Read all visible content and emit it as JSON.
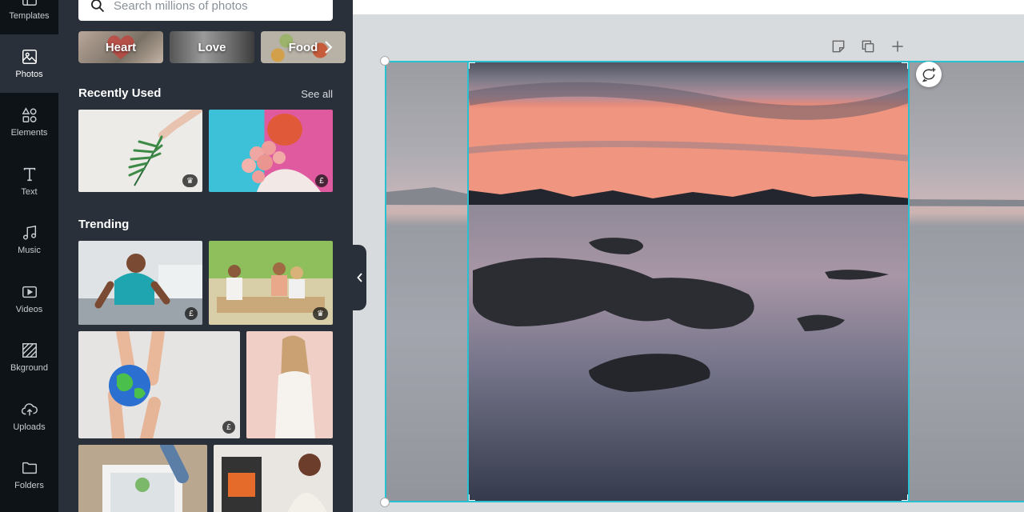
{
  "rail": {
    "items": [
      {
        "label": "Templates",
        "icon": "templates-icon"
      },
      {
        "label": "Photos",
        "icon": "photos-icon"
      },
      {
        "label": "Elements",
        "icon": "elements-icon"
      },
      {
        "label": "Text",
        "icon": "text-icon"
      },
      {
        "label": "Music",
        "icon": "music-icon"
      },
      {
        "label": "Videos",
        "icon": "videos-icon"
      },
      {
        "label": "Bkground",
        "icon": "background-icon"
      },
      {
        "label": "Uploads",
        "icon": "uploads-icon"
      },
      {
        "label": "Folders",
        "icon": "folders-icon"
      }
    ],
    "active": "Photos"
  },
  "search": {
    "placeholder": "Search millions of photos"
  },
  "chips": [
    {
      "label": "Heart"
    },
    {
      "label": "Love"
    },
    {
      "label": "Food"
    }
  ],
  "recently_used": {
    "title": "Recently Used",
    "see_all": "See all",
    "items": [
      {
        "subject": "fern leaf in hand",
        "badge": "crown"
      },
      {
        "subject": "woman with pink roses",
        "badge": "£"
      }
    ]
  },
  "trending": {
    "title": "Trending",
    "items": [
      {
        "subject": "man in kitchen",
        "badge": "£"
      },
      {
        "subject": "family dinner outdoors",
        "badge": "crown"
      },
      {
        "subject": "hands holding globe",
        "badge": "£"
      },
      {
        "subject": "woman against pink wall",
        "badge": ""
      },
      {
        "subject": "kitchen sink",
        "badge": ""
      },
      {
        "subject": "woman by fireplace",
        "badge": ""
      }
    ]
  },
  "colors": {
    "rail_bg": "#0e1318",
    "panel_bg": "#293039",
    "selection": "#27c1d2",
    "workspace_bg": "#d8dbde"
  },
  "canvas": {
    "tools": [
      "notes-icon",
      "duplicate-icon",
      "add-page-icon"
    ],
    "image_subject": "long exposure sunset over sea with rocks"
  }
}
